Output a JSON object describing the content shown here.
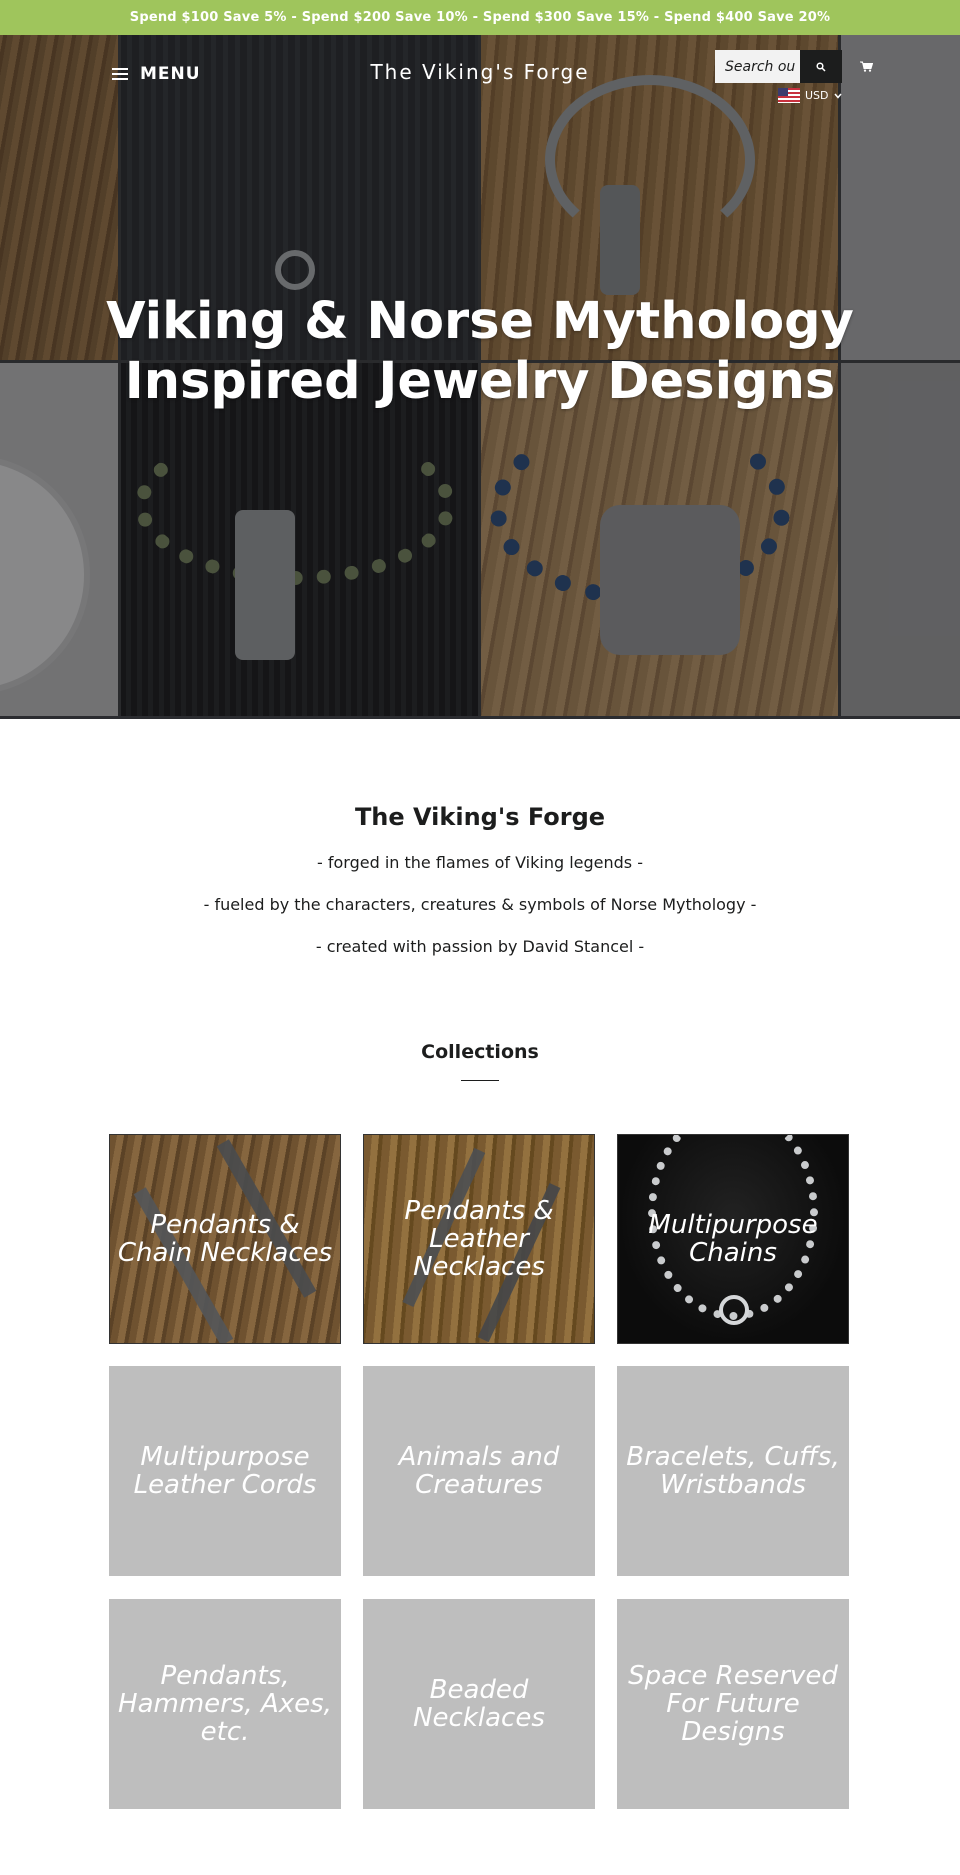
{
  "announcement": "Spend $100 Save 5% - Spend $200 Save 10% - Spend $300 Save 15% - Spend $400 Save 20%",
  "header": {
    "menu_label": "MENU",
    "site_title": "The Viking's Forge",
    "search_placeholder": "Search our store",
    "search_value": "Search ou",
    "currency": "USD"
  },
  "hero": {
    "heading": "Viking & Norse Mythology Inspired Jewelry Designs"
  },
  "about": {
    "title": "The Viking's Forge",
    "lines": [
      "- forged in the flames of Viking legends -",
      "- fueled by the characters, creatures & symbols of Norse Mythology -",
      "- created with passion by David Stancel -"
    ]
  },
  "collections": {
    "title": "Collections",
    "items": [
      "Pendants & Chain Necklaces",
      "Pendants & Leather Necklaces",
      "Multipurpose Chains",
      "Multipurpose Leather Cords",
      "Animals and Creatures",
      "Bracelets, Cuffs, Wristbands",
      "Pendants, Hammers, Axes, etc.",
      "Beaded Necklaces",
      "Space Reserved For Future Designs"
    ]
  },
  "colors": {
    "announcement_bg": "#9fc55c",
    "placeholder_card": "#bebebe",
    "text": "#1c1d1d"
  }
}
